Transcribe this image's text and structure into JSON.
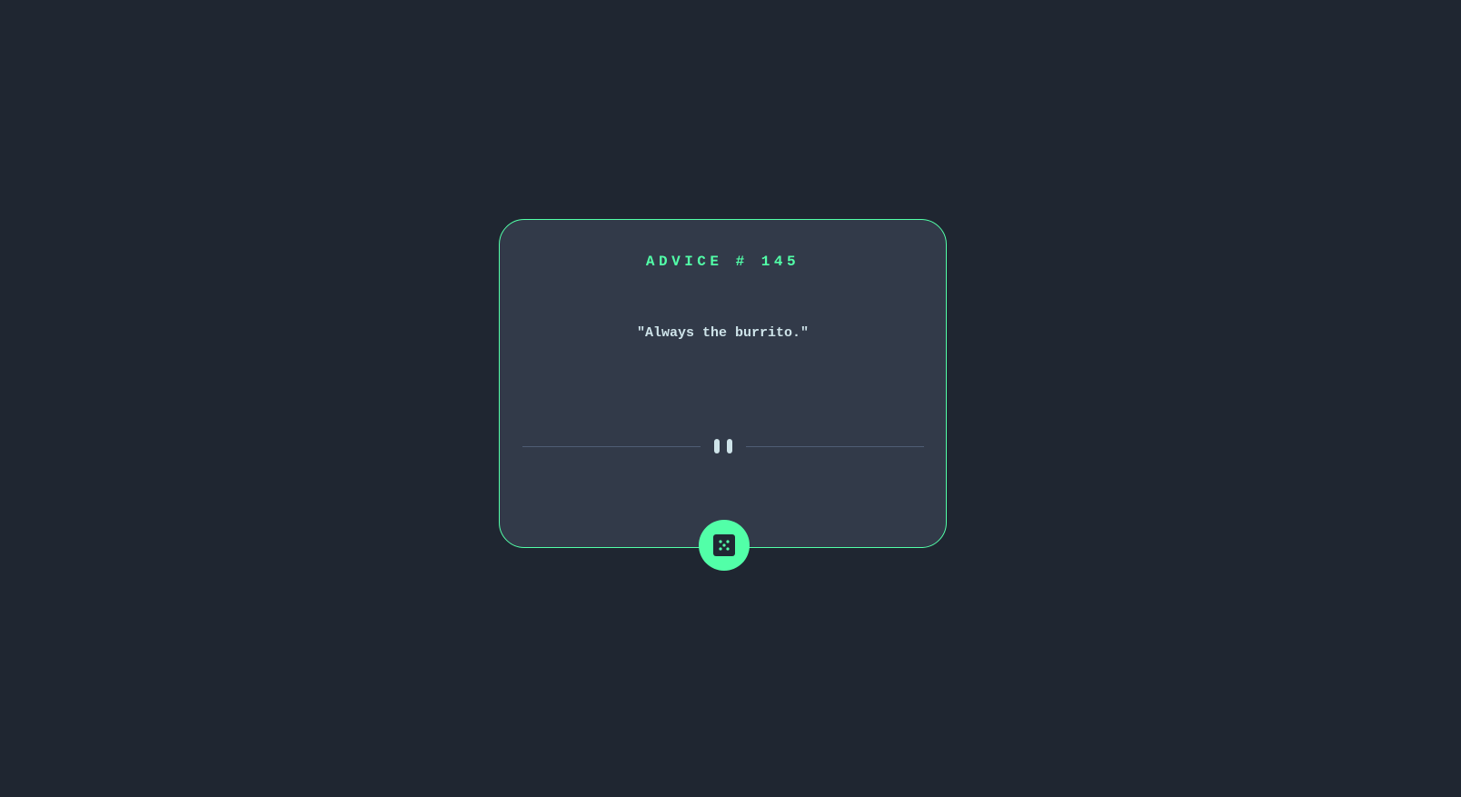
{
  "colors": {
    "background": "#1f2631",
    "card": "#323a49",
    "accent": "#52ffa8",
    "text": "#cee3e9",
    "divider": "#4f5d74"
  },
  "advice": {
    "title": "ADVICE # 145",
    "quote": "\"Always the burrito.\""
  },
  "icons": {
    "divider": "pause-icon",
    "button": "dice-icon"
  }
}
